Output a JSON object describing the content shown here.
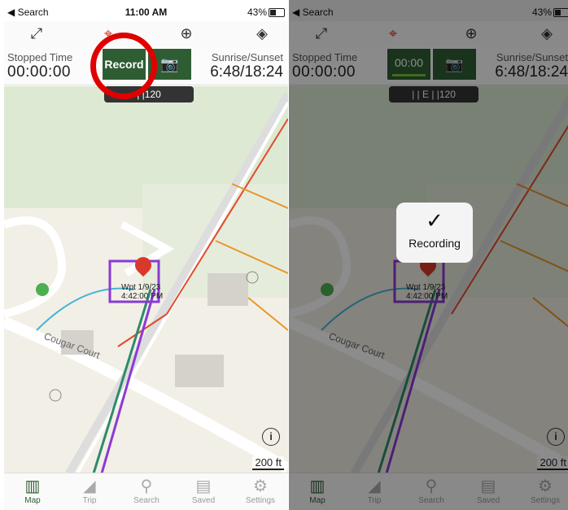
{
  "status_bar": {
    "back_label": "◀ Search",
    "time": "11:00 AM",
    "battery": "43%"
  },
  "toolbar": {
    "icons": [
      "expand-icon",
      "crosshair-icon",
      "add-icon",
      "layers-icon"
    ]
  },
  "panel": {
    "stopped_label": "Stopped Time",
    "stopped_value": "00:00:00",
    "record_label": "Record",
    "timer_value": "00:00",
    "sun_label": "Sunrise/Sunset",
    "sun_value": "6:48/18:24"
  },
  "compass_left": "| |120",
  "compass_right": "| | E | |120",
  "map": {
    "street": "Cougar Court",
    "waypoint": "Wpt 1/9/23 4:42:00 PM",
    "scale": "200 ft",
    "info": "i"
  },
  "toast": {
    "check": "✓",
    "label": "Recording"
  },
  "tabs": [
    {
      "label": "Map",
      "icon": "map-icon"
    },
    {
      "label": "Trip",
      "icon": "chart-icon"
    },
    {
      "label": "Search",
      "icon": "search-icon"
    },
    {
      "label": "Saved",
      "icon": "folder-icon"
    },
    {
      "label": "Settings",
      "icon": "gear-icon"
    }
  ],
  "colors": {
    "accent": "#2f5d33",
    "record_highlight": "#e00000",
    "timer_bar": "#7dc23a"
  }
}
